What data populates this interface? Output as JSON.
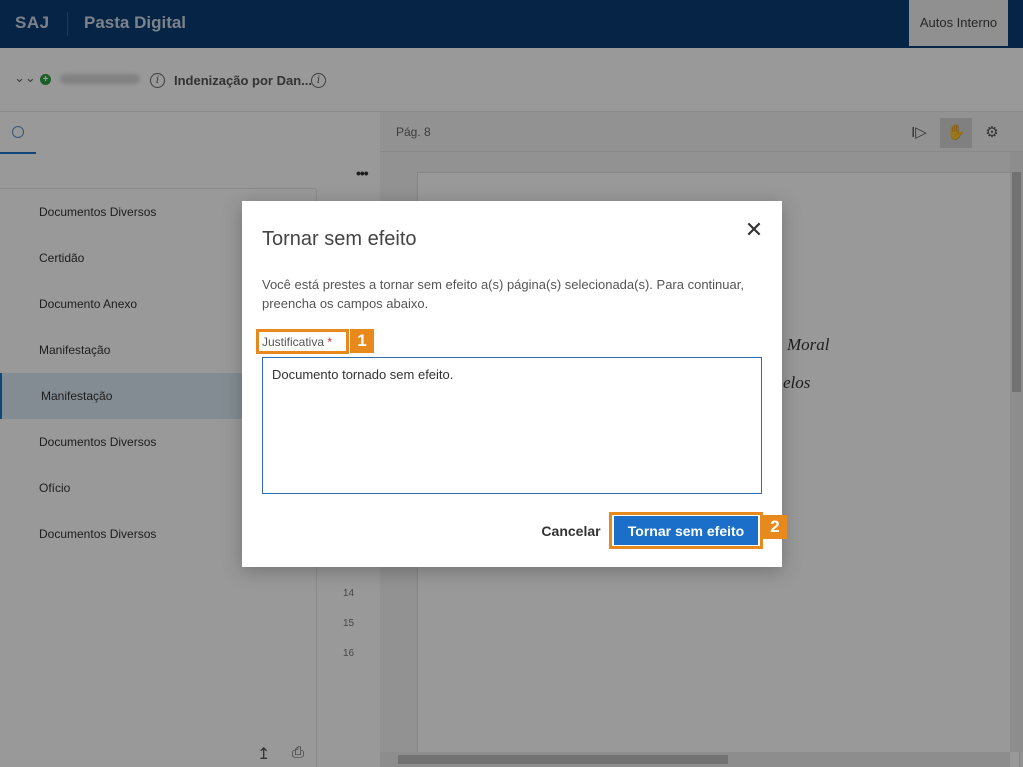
{
  "header": {
    "brand": "SAJ",
    "title": "Pasta Digital",
    "tab_label": "Autos Interno"
  },
  "process": {
    "subject": "Indenização por Dan..."
  },
  "document_list": {
    "items": [
      {
        "label": "Documentos Diversos"
      },
      {
        "label": "Certidão"
      },
      {
        "label": "Documento Anexo"
      },
      {
        "label": "Manifestação"
      },
      {
        "label": "Manifestação",
        "selected": true
      },
      {
        "label": "Documentos Diversos"
      },
      {
        "label": "Ofício"
      },
      {
        "label": "Documentos Diversos"
      }
    ],
    "page_numbers": [
      "14",
      "15",
      "16"
    ]
  },
  "viewer": {
    "page_label": "Pág. 8",
    "visible_text": [
      "Moral",
      "elos"
    ]
  },
  "modal": {
    "title": "Tornar sem efeito",
    "description": "Você está prestes a tornar sem efeito a(s) página(s) selecionada(s). Para continuar, preencha os campos abaixo.",
    "field_label": "Justificativa",
    "required_marker": "*",
    "field_value": "Documento tornado sem efeito.",
    "cancel_label": "Cancelar",
    "confirm_label": "Tornar sem efeito",
    "callouts": [
      "1",
      "2"
    ]
  },
  "colors": {
    "header_bg": "#0b3c73",
    "primary_button": "#1b6fc8",
    "callout": "#e8891e",
    "required": "#d0282e"
  }
}
